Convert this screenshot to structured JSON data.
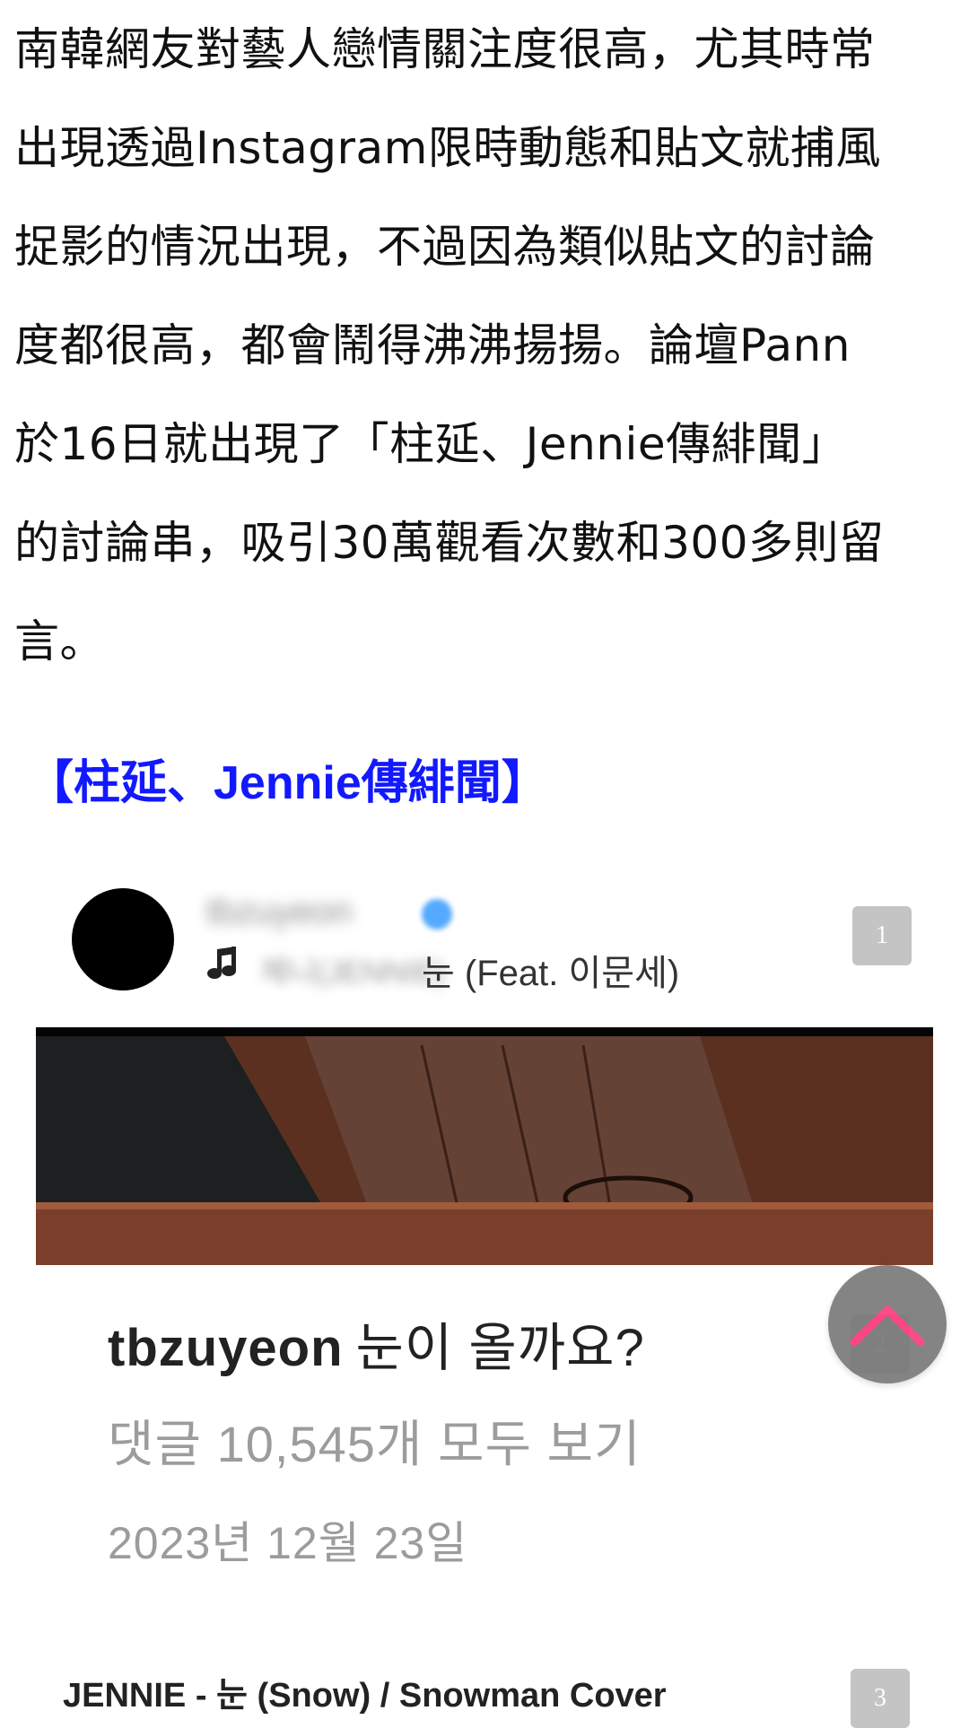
{
  "article": {
    "lines": [
      "南韓網友對藝人戀情關注度很高，尤其時常",
      "出現透過Instagram限時動態和貼文就捕風",
      "捉影的情況出現，不過因為類似貼文的討論",
      "度都很高，都會鬧得沸沸揚揚。論壇Pann",
      "於16日就出現了「柱延、Jennie傳緋聞」",
      "的討論串，吸引30萬觀看次數和300多則留",
      "言。"
    ]
  },
  "section_title": "【柱延、Jennie傳緋聞】",
  "embed": {
    "username_blurred": "tbzuyeon",
    "music_blurred": "제니(JENNIE)",
    "music_text": "눈 (Feat. 이문세)",
    "badges": [
      "1",
      "2",
      "3"
    ],
    "caption_user": "tbzuyeon",
    "caption_text": "눈이 올까요?",
    "comments_link": "댓글 10,545개 모두 보기",
    "date": "2023년 12월 23일",
    "video_title": "JENNIE - 눈 (Snow) / Snowman Cover"
  },
  "colors": {
    "section_title": "#1219ff",
    "back_to_top_arrow": "#ff3d7f"
  },
  "icons": {
    "music": "music-note-icon",
    "back_to_top": "chevron-up-icon",
    "verified": "verified-badge-icon"
  }
}
